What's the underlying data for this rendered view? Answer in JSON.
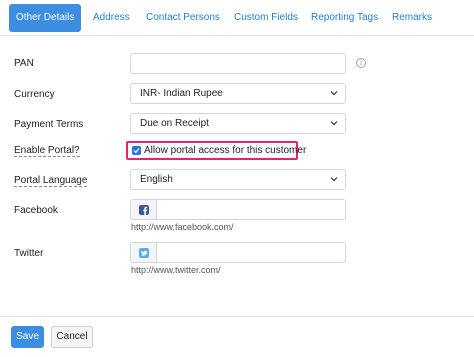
{
  "tabs": [
    {
      "label": "Other Details",
      "active": true
    },
    {
      "label": "Address"
    },
    {
      "label": "Contact Persons"
    },
    {
      "label": "Custom Fields"
    },
    {
      "label": "Reporting Tags"
    },
    {
      "label": "Remarks"
    }
  ],
  "form": {
    "pan": {
      "label": "PAN",
      "value": ""
    },
    "currency": {
      "label": "Currency",
      "value": "INR- Indian Rupee"
    },
    "payment_terms": {
      "label": "Payment Terms",
      "value": "Due on Receipt"
    },
    "enable_portal": {
      "label": "Enable Portal?",
      "checkbox_label": "Allow portal access for this customer",
      "checked": true
    },
    "portal_language": {
      "label": "Portal Language",
      "value": "English"
    },
    "facebook": {
      "label": "Facebook",
      "value": "",
      "hint": "http://www.facebook.com/"
    },
    "twitter": {
      "label": "Twitter",
      "value": "",
      "hint": "http://www.twitter.com/"
    }
  },
  "footer": {
    "save_label": "Save",
    "cancel_label": "Cancel"
  },
  "colors": {
    "accent": "#3d8ee0",
    "highlight": "#e0266f",
    "facebook": "#3b5998",
    "twitter": "#55acee"
  },
  "icons": {
    "pan_info": "info-icon",
    "dropdown": "chevron-down-icon",
    "facebook": "facebook-icon",
    "twitter": "twitter-icon",
    "checkbox": "checkmark-icon"
  }
}
